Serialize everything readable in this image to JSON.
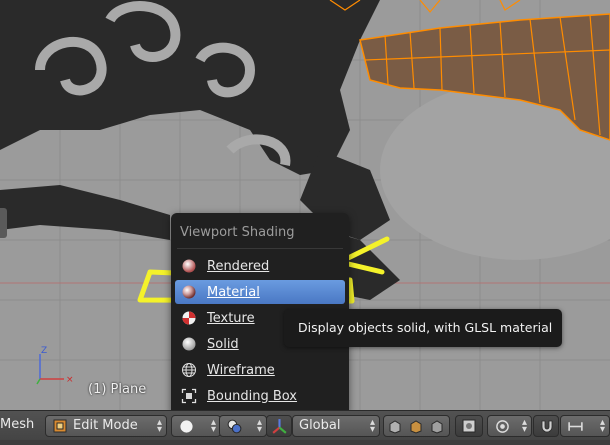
{
  "popup": {
    "title": "Viewport Shading",
    "items": [
      {
        "label": "Rendered",
        "icon": "rendered-sphere-icon",
        "active": false
      },
      {
        "label": "Material",
        "icon": "material-sphere-icon",
        "active": true
      },
      {
        "label": "Texture",
        "icon": "texture-sphere-icon",
        "active": false
      },
      {
        "label": "Solid",
        "icon": "solid-sphere-icon",
        "active": false
      },
      {
        "label": "Wireframe",
        "icon": "wireframe-sphere-icon",
        "active": false
      },
      {
        "label": "Bounding Box",
        "icon": "bounding-box-icon",
        "active": false
      }
    ]
  },
  "tooltip": {
    "text": "Display objects solid, with GLSL material"
  },
  "viewport": {
    "object_label": "(1) Plane",
    "axis_z": "Z"
  },
  "header": {
    "mesh_menu": "Mesh",
    "mode": "Edit Mode",
    "orientation": "Global"
  },
  "colors": {
    "highlight_annotation": "#f4f22a",
    "menu_active": "#5a88d4",
    "mesh_fill": "#7a5c45",
    "mesh_edge": "#ff8c00"
  }
}
